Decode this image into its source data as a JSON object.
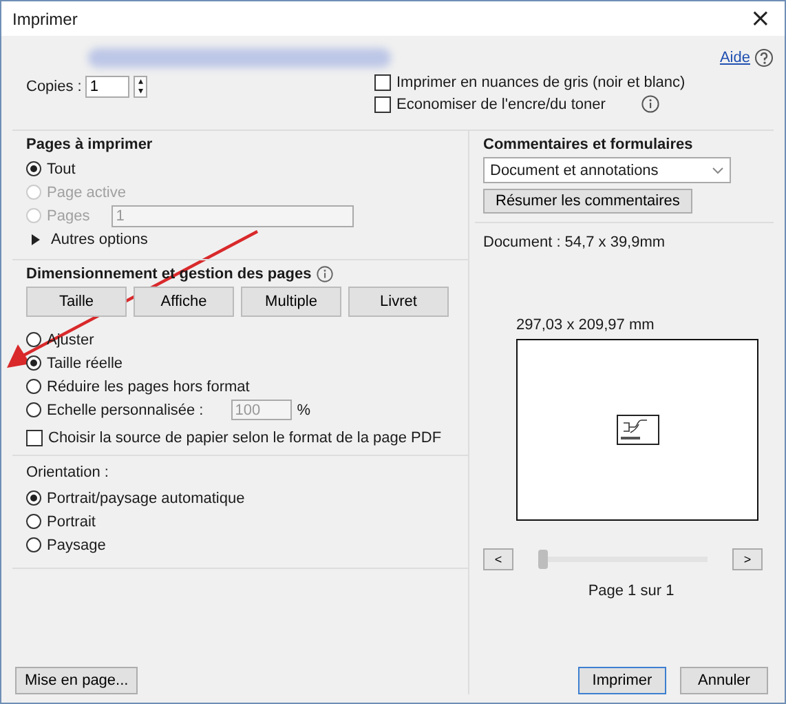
{
  "window": {
    "title": "Imprimer",
    "close": "×"
  },
  "header": {
    "help_link": "Aide"
  },
  "copies": {
    "label": "Copies :",
    "value": "1",
    "up": "▴",
    "down": "▾"
  },
  "print_options": [
    {
      "label": "Imprimer en nuances de gris (noir et blanc)",
      "checked": false,
      "info": false
    },
    {
      "label": "Economiser de l'encre/du toner",
      "checked": false,
      "info": true
    }
  ],
  "pages_to_print": {
    "title": "Pages à imprimer",
    "options": [
      {
        "label": "Tout",
        "selected": true,
        "disabled": false
      },
      {
        "label": "Page active",
        "selected": false,
        "disabled": true
      },
      {
        "label": "Pages",
        "selected": false,
        "disabled": true,
        "field": "1"
      }
    ],
    "more_options": "Autres options"
  },
  "sizing": {
    "title": "Dimensionnement et gestion des pages",
    "modes": [
      "Taille",
      "Affiche",
      "Multiple",
      "Livret"
    ],
    "options": [
      {
        "label": "Ajuster",
        "selected": false
      },
      {
        "label": "Taille réelle",
        "selected": true
      },
      {
        "label": "Réduire les pages hors format",
        "selected": false
      },
      {
        "label": "Echelle personnalisée :",
        "selected": false,
        "field": "100",
        "unit": "%"
      }
    ],
    "paper_source": {
      "label": "Choisir la source de papier selon le format de la page PDF",
      "checked": false
    }
  },
  "orientation": {
    "title": "Orientation :",
    "options": [
      {
        "label": "Portrait/paysage automatique",
        "selected": true
      },
      {
        "label": "Portrait",
        "selected": false
      },
      {
        "label": "Paysage",
        "selected": false
      }
    ]
  },
  "comments": {
    "title": "Commentaires et formulaires",
    "dropdown": "Document et annotations",
    "button": "Résumer les commentaires"
  },
  "preview": {
    "document_size": "Document : 54,7 x 39,9mm",
    "page_size": "297,03 x 209,97 mm",
    "prev": "<",
    "next": ">",
    "slider": {
      "level": 0
    },
    "page_label": "Page 1 sur 1"
  },
  "buttons": {
    "setup": "Mise en page...",
    "print": "Imprimer",
    "cancel": "Annuler"
  }
}
